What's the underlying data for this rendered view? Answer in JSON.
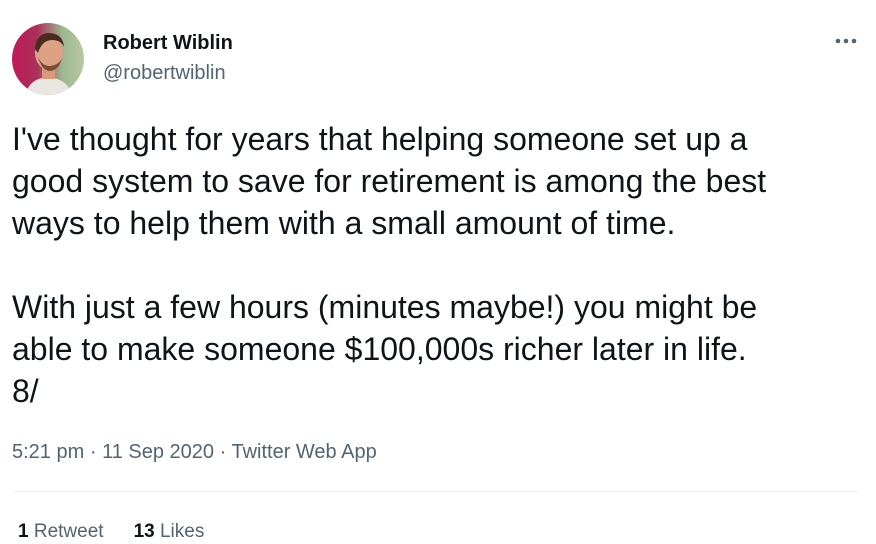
{
  "author": {
    "display_name": "Robert Wiblin",
    "handle": "@robertwiblin"
  },
  "menu": {
    "icon": "more-horizontal-icon"
  },
  "tweet": {
    "paragraph_1": "I've thought for years that helping someone set up a\ngood system to save for retirement is among the best\nways to help them with a small amount of time.",
    "paragraph_2": "With just a few hours (minutes maybe!) you might be\nable to make someone $100,000s richer later in life.\n8/"
  },
  "meta": {
    "time": "5:21 pm",
    "separator": "·",
    "date": "11 Sep 2020",
    "source": "Twitter Web App"
  },
  "stats": {
    "retweets_count": "1",
    "retweets_label": "Retweet",
    "likes_count": "13",
    "likes_label": "Likes"
  },
  "colors": {
    "text_primary": "#0f1419",
    "text_secondary": "#536471",
    "divider": "#eff3f4"
  }
}
